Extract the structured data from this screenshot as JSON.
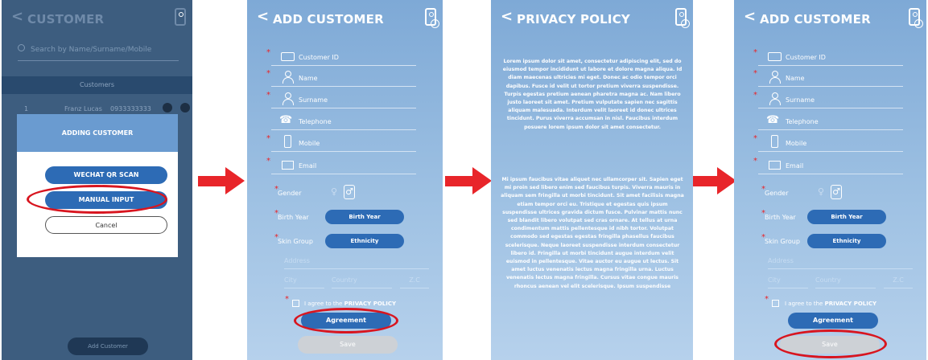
{
  "screen1": {
    "title": "CUSTOMER",
    "search_placeholder": "Search by Name/Surname/Mobile",
    "tab": "Customers",
    "row": {
      "num": "1",
      "name": "Franz Lucas",
      "phone": "0933333333"
    },
    "dialog": {
      "title": "ADDING CUSTOMER",
      "wechat": "WECHAT QR SCAN",
      "manual": "MANUAL INPUT",
      "cancel": "Cancel"
    },
    "add_button": "Add Customer"
  },
  "form": {
    "title": "ADD CUSTOMER",
    "customer_id": "Customer ID",
    "name": "Name",
    "surname": "Surname",
    "telephone": "Telephone",
    "mobile": "Mobile",
    "email": "Email",
    "gender": "Gender",
    "birth_year_label": "Birth Year",
    "birth_year_btn": "Birth Year",
    "skin_group_label": "Skin Group",
    "ethnicity_btn": "Ethnicity",
    "address": "Address",
    "city": "City",
    "country": "Country",
    "zc": "Z.C",
    "agree_prefix": "I agree to the",
    "agree_link": "PRIVACY POLICY",
    "agreement": "Agreement",
    "save": "Save"
  },
  "privacy": {
    "title": "PRIVACY POLICY",
    "para1": "Lorem ipsum dolor sit amet, consectetur adipiscing elit, sed do eiusmod tempor incididunt ut labore et dolore magna aliqua. Id diam maecenas ultricies mi eget. Donec ac odio tempor orci dapibus. Fusce id velit ut tortor pretium viverra suspendisse. Turpis egestas pretium aenean pharetra magna ac. Nam libero justo laoreet sit amet. Pretium vulputate sapien nec sagittis aliquam malesuada. Interdum velit laoreet id donec ultrices tincidunt. Purus viverra accumsan in nisl. Faucibus interdum posuere lorem ipsum dolor sit amet consectetur.",
    "para2": "Mi ipsum faucibus vitae aliquet nec ullamcorper sit. Sapien eget mi proin sed libero enim sed faucibus turpis. Viverra mauris in aliquam sem fringilla ut morbi tincidunt. Sit amet facilisis magna etiam tempor orci eu. Tristique et egestas quis ipsum suspendisse ultrices gravida dictum fusce. Pulvinar mattis nunc sed blandit libero volutpat sed cras ornare. At tellus at urna condimentum mattis pellentesque id nibh tortor. Volutpat commodo sed egestas egestas fringilla phasellus faucibus scelerisque. Neque laoreet suspendisse interdum consectetur libero id. Fringilla ut morbi tincidunt augue interdum velit euismod in pellentesque. Vitae auctor eu augue ut lectus. Sit amet luctus venenatis lectus magna fringilla urna. Luctus venenatis lectus magna fringilla. Cursus vitae congue mauris rhoncus aenean vel elit scelerisque. Ipsum suspendisse"
  },
  "colors": {
    "arrow": "#e8252a",
    "highlight": "#d8151f",
    "primary": "#2d6bb5"
  }
}
